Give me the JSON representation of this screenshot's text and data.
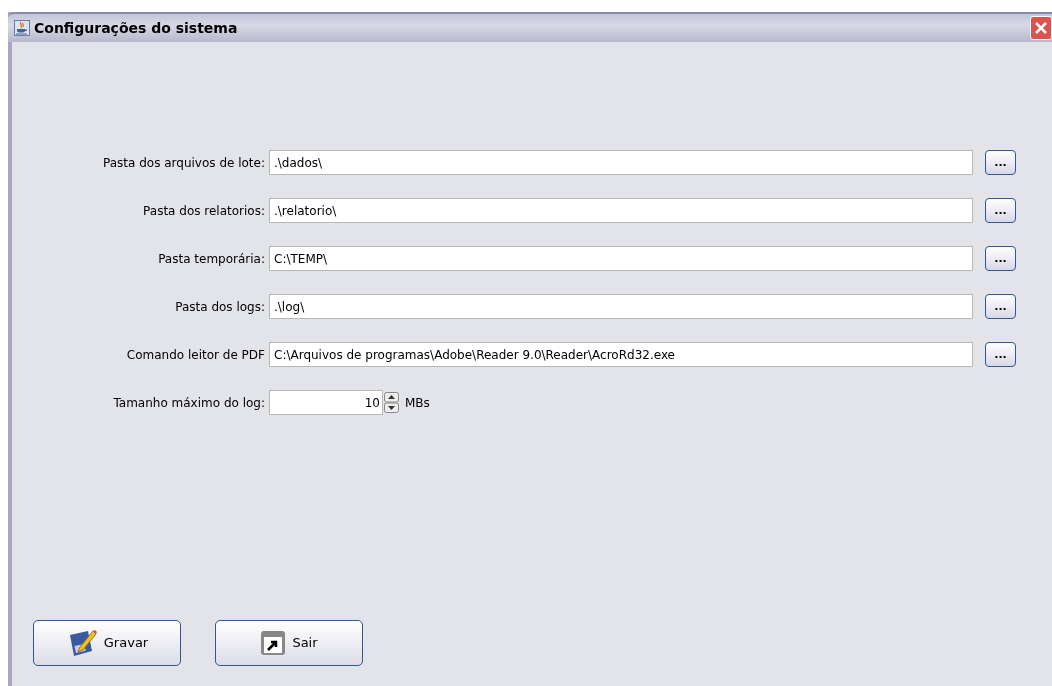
{
  "window": {
    "title": "Configurações do sistema"
  },
  "fields": [
    {
      "label": "Pasta dos arquivos de lote:",
      "value": ".\\dados\\",
      "browse": "..."
    },
    {
      "label": "Pasta dos relatorios:",
      "value": ".\\relatorio\\",
      "browse": "..."
    },
    {
      "label": "Pasta temporária:",
      "value": "C:\\TEMP\\",
      "browse": "..."
    },
    {
      "label": "Pasta dos logs:",
      "value": ".\\log\\",
      "browse": "..."
    },
    {
      "label": "Comando leitor de PDF",
      "value": "C:\\Arquivos de programas\\Adobe\\Reader 9.0\\Reader\\AcroRd32.exe",
      "browse": "..."
    }
  ],
  "log_size": {
    "label": "Tamanho máximo do log:",
    "value": "10",
    "unit": "MBs"
  },
  "buttons": [
    {
      "label": "Gravar",
      "kind": "save"
    },
    {
      "label": "Sair",
      "kind": "exit"
    }
  ]
}
